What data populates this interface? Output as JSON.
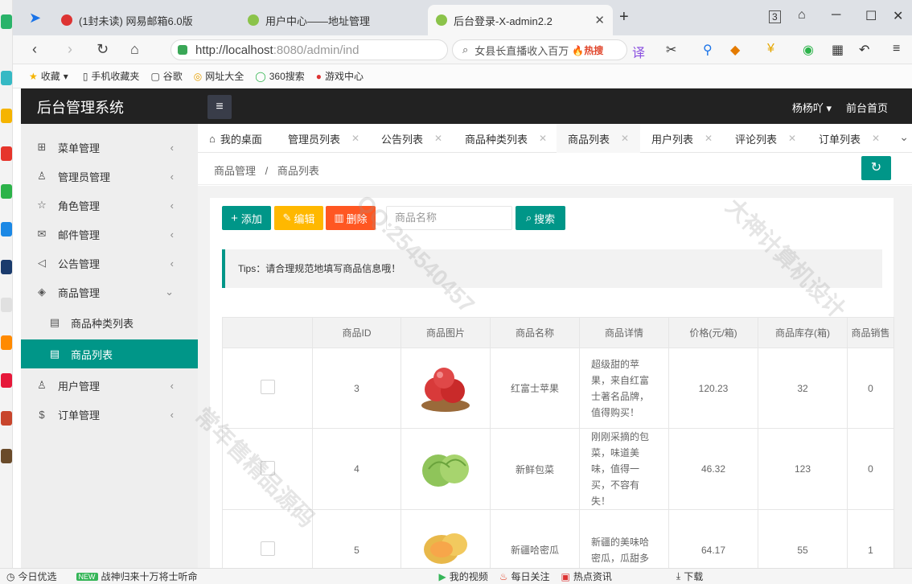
{
  "browser": {
    "tabs": [
      {
        "title": "(1封未读) 网易邮箱6.0版",
        "icon": "netease-mail-icon"
      },
      {
        "title": "用户中心——地址管理",
        "icon": "leaf-icon"
      },
      {
        "title": "后台登录-X-admin2.2",
        "icon": "leaf-icon"
      }
    ],
    "new_tab": "+",
    "url_host": "http://localhost",
    "url_path": ":8080/admin/ind",
    "search_text": "女县长直播收入百万",
    "search_hot": "🔥热搜",
    "bookmarks": [
      "收藏",
      "手机收藏夹",
      "谷歌",
      "网址大全",
      "360搜索",
      "游戏中心"
    ]
  },
  "header": {
    "title": "后台管理系统",
    "menu_icon": "≡",
    "user": "杨杨吖",
    "front_link": "前台首页"
  },
  "sidebar": {
    "items": [
      {
        "label": "菜单管理",
        "icon": "grid-icon"
      },
      {
        "label": "管理员管理",
        "icon": "person-icon"
      },
      {
        "label": "角色管理",
        "icon": "star-icon"
      },
      {
        "label": "邮件管理",
        "icon": "mail-icon"
      },
      {
        "label": "公告管理",
        "icon": "speaker-icon"
      },
      {
        "label": "商品管理",
        "icon": "cube-icon"
      },
      {
        "label": "商品种类列表",
        "icon": "list-icon"
      },
      {
        "label": "商品列表",
        "icon": "list-icon"
      },
      {
        "label": "用户管理",
        "icon": "person-icon"
      },
      {
        "label": "订单管理",
        "icon": "dollar-icon"
      }
    ]
  },
  "content_tabs": [
    "我的桌面",
    "管理员列表",
    "公告列表",
    "商品种类列表",
    "商品列表",
    "用户列表",
    "评论列表",
    "订单列表"
  ],
  "breadcrumb": [
    "商品管理",
    "/",
    "商品列表"
  ],
  "toolbar": {
    "add": "添加",
    "edit": "编辑",
    "delete": "删除",
    "search_placeholder": "商品名称",
    "search": "搜索"
  },
  "tips": "Tips：请合理规范地填写商品信息哦！",
  "table": {
    "headers": [
      "",
      "商品ID",
      "商品图片",
      "商品名称",
      "商品详情",
      "价格(元/箱)",
      "商品库存(箱)",
      "商品销售"
    ],
    "rows": [
      {
        "id": "3",
        "name": "红富士苹果",
        "detail": "超级甜的苹果，来自红富士著名品牌，值得购买！",
        "price": "120.23",
        "stock": "32",
        "sales": "0",
        "image": "apple-image"
      },
      {
        "id": "4",
        "name": "新鲜包菜",
        "detail": "刚刚采摘的包菜，味道美味，值得一买，不容有失！",
        "price": "46.32",
        "stock": "123",
        "sales": "0",
        "image": "cabbage-image"
      },
      {
        "id": "5",
        "name": "新疆哈密瓜",
        "detail": "新疆的美味哈密瓜，瓜甜多",
        "price": "64.17",
        "stock": "55",
        "sales": "1",
        "image": "melon-image"
      }
    ]
  },
  "statusbar": [
    "今日优选",
    "战神归来十万将士听命",
    "我的视频",
    "每日关注",
    "热点资讯",
    "下载"
  ],
  "watermarks": [
    "QQ:254540457",
    "大神计算机设计",
    "常年售精品源码"
  ],
  "colors": {
    "accent": "#009688",
    "edit": "#ffb800",
    "delete": "#ff5722",
    "header": "#222222"
  }
}
